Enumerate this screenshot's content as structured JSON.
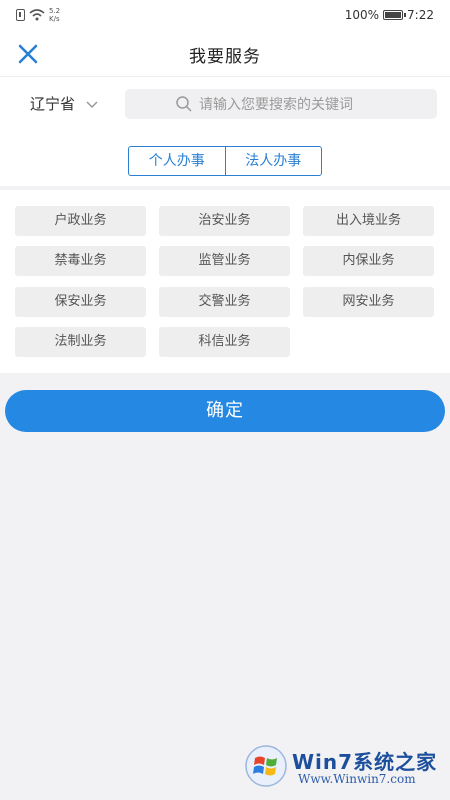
{
  "status_bar": {
    "speed_value": "5.2",
    "speed_unit": "K/s",
    "battery": "100%",
    "time": "7:22"
  },
  "header": {
    "title": "我要服务"
  },
  "search": {
    "province": "辽宁省",
    "placeholder": "请输入您要搜索的关键词"
  },
  "tabs": [
    {
      "label": "个人办事"
    },
    {
      "label": "法人办事"
    }
  ],
  "categories": [
    {
      "label": "户政业务"
    },
    {
      "label": "治安业务"
    },
    {
      "label": "出入境业务"
    },
    {
      "label": "禁毒业务"
    },
    {
      "label": "监管业务"
    },
    {
      "label": "内保业务"
    },
    {
      "label": "保安业务"
    },
    {
      "label": "交警业务"
    },
    {
      "label": "网安业务"
    },
    {
      "label": "法制业务"
    },
    {
      "label": "科信业务"
    }
  ],
  "confirm": {
    "label": "确定"
  },
  "watermark": {
    "text": "Win7系统之家",
    "url": "Www.Winwin7.com"
  },
  "colors": {
    "accent": "#2589e3",
    "tab_border": "#2a7fd4",
    "chip_bg": "#eeeeee",
    "page_bg": "#f2f2f4"
  }
}
